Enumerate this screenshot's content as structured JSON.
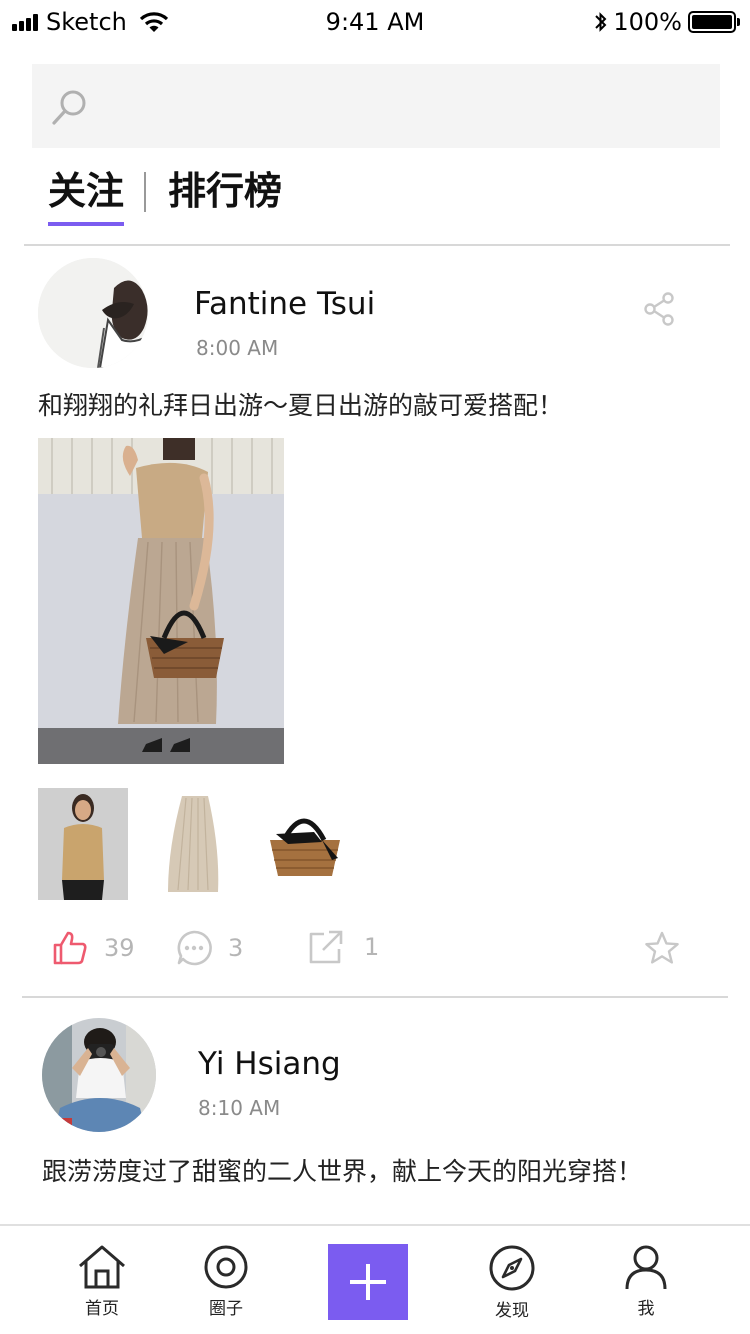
{
  "status_bar": {
    "carrier": "Sketch",
    "time": "9:41 AM",
    "battery": "100%"
  },
  "search": {
    "placeholder": ""
  },
  "tabs": [
    {
      "label": "关注",
      "active": true
    },
    {
      "label": "排行榜",
      "active": false
    }
  ],
  "accent_color": "#7b5cf0",
  "posts": [
    {
      "author": "Fantine Tsui",
      "time": "8:00 AM",
      "caption": "和翔翔的礼拜日出游～夏日出游的敲可爱搭配！",
      "likes": "39",
      "comments": "3",
      "shares": "1",
      "liked": true
    },
    {
      "author": "Yi Hsiang",
      "time": "8:10 AM",
      "caption": "跟涝涝度过了甜蜜的二人世界，献上今天的阳光穿搭！"
    }
  ],
  "tab_bar": {
    "items": [
      {
        "label": "首页",
        "icon": "home-icon"
      },
      {
        "label": "圈子",
        "icon": "circle-icon"
      },
      {
        "label": "",
        "icon": "plus-icon"
      },
      {
        "label": "发现",
        "icon": "compass-icon"
      },
      {
        "label": "我",
        "icon": "user-icon"
      }
    ]
  }
}
